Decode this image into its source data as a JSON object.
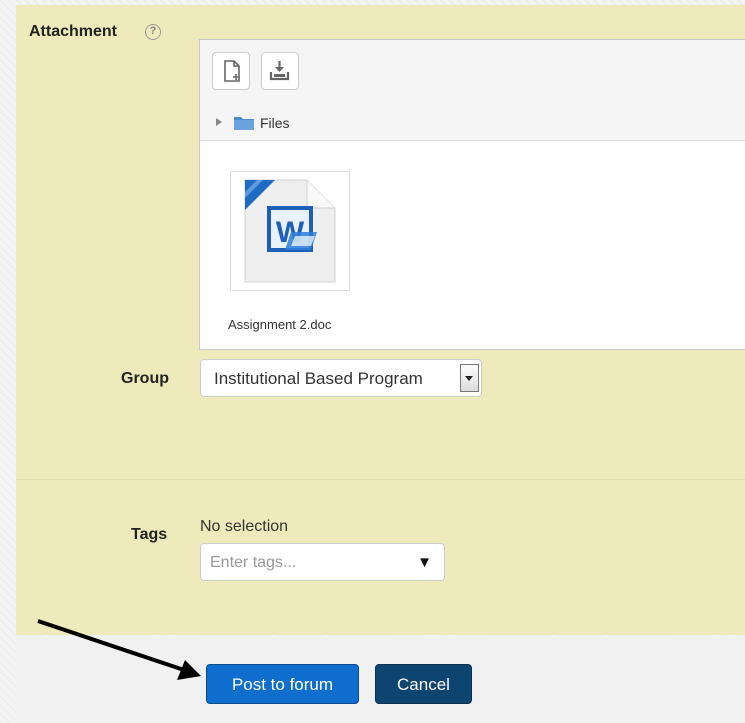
{
  "form": {
    "attachment_label": "Attachment",
    "help_icon": "question-circle-icon",
    "filepicker": {
      "toolbar": [
        {
          "name": "add-file-icon"
        },
        {
          "name": "download-icon"
        }
      ],
      "path_label": "Files",
      "files": [
        {
          "name": "Assignment 2.doc",
          "icon": "word-document-icon"
        }
      ]
    },
    "group": {
      "label": "Group",
      "selected": "Institutional Based Program"
    },
    "tags": {
      "label": "Tags",
      "status": "No selection",
      "placeholder": "Enter tags..."
    }
  },
  "actions": {
    "post_label": "Post to forum",
    "cancel_label": "Cancel"
  },
  "colors": {
    "panel": "#efeabc",
    "primary": "#0f6ecd",
    "secondary": "#0e4470"
  }
}
